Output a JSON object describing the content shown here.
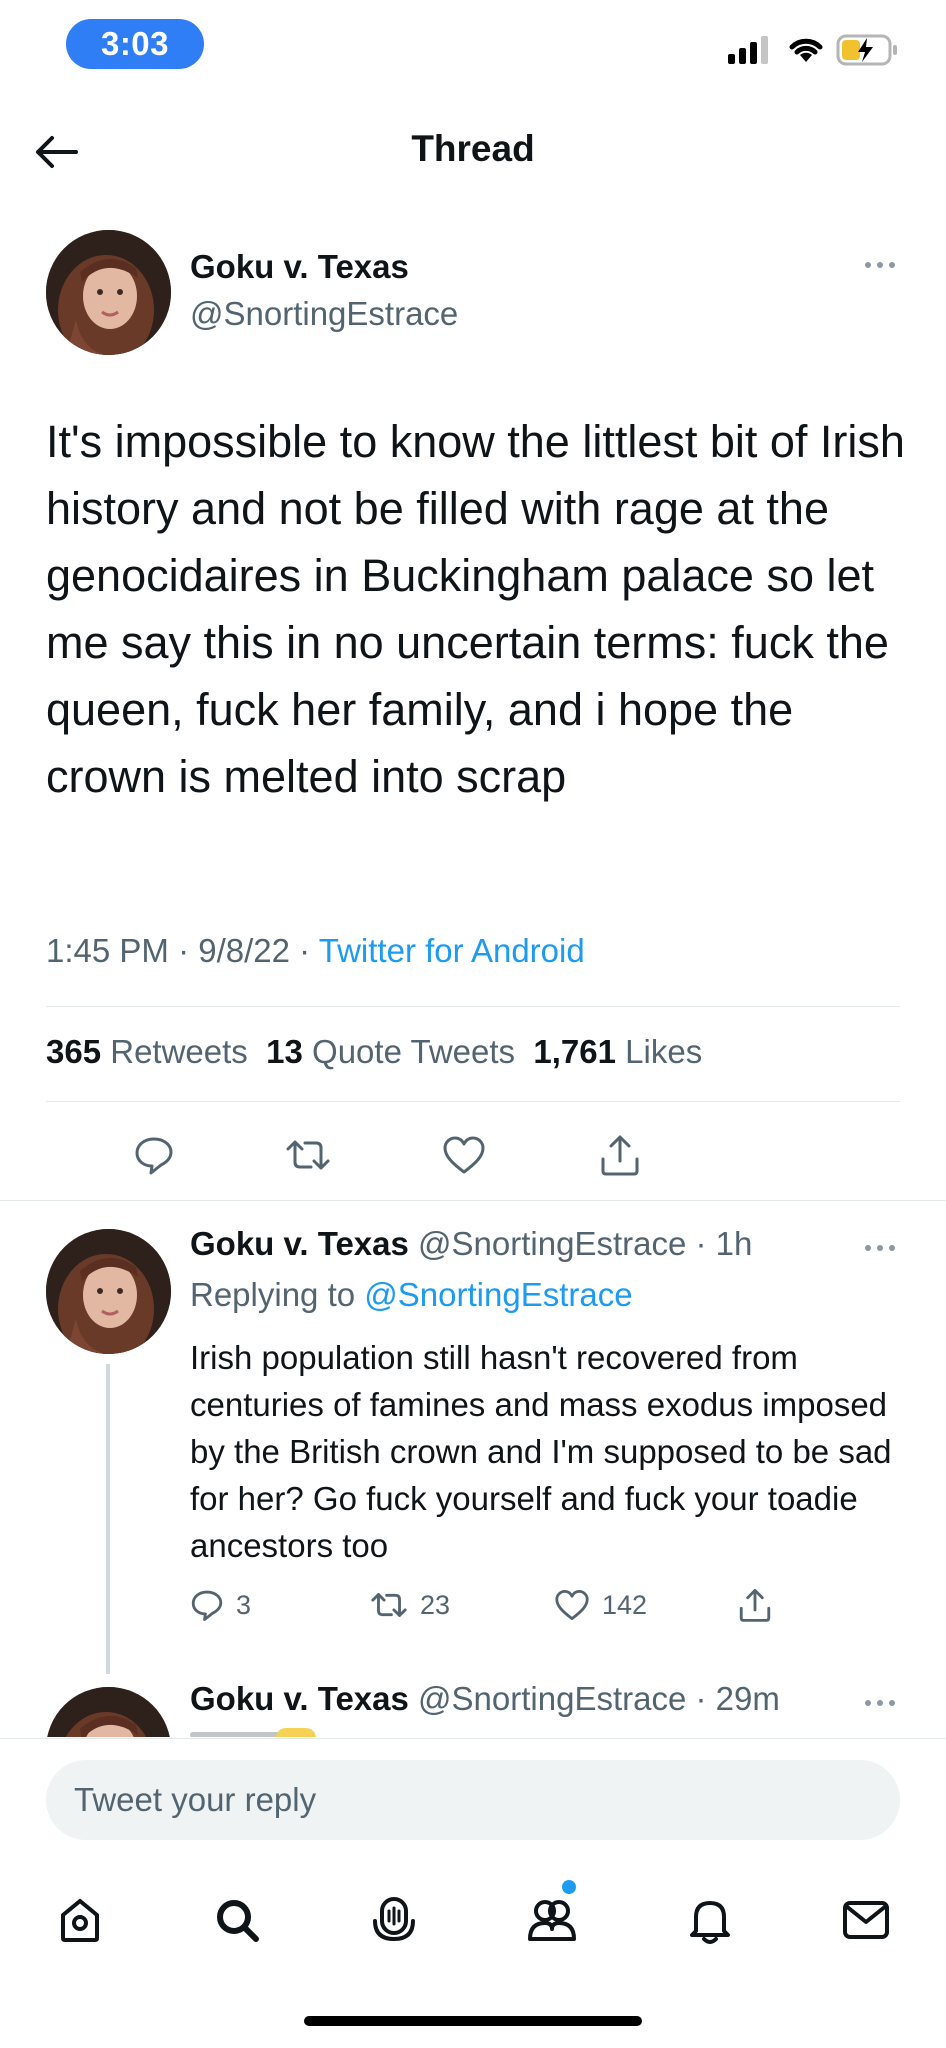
{
  "status_bar": {
    "time": "3:03"
  },
  "header": {
    "title": "Thread"
  },
  "main_tweet": {
    "display_name": "Goku v. Texas",
    "handle": "@SnortingEstrace",
    "text": "It's impossible to know the littlest bit of Irish history and not be filled with rage at the genocidaires in Buckingham palace so let me say this in no uncertain terms: fuck the queen, fuck her family, and i hope the crown is melted into scrap",
    "time": "1:45 PM",
    "separator": "·",
    "date": "9/8/22",
    "source": "Twitter for Android",
    "retweets_count": "365",
    "retweets_label": "Retweets",
    "quotes_count": "13",
    "quotes_label": "Quote Tweets",
    "likes_count": "1,761",
    "likes_label": "Likes"
  },
  "replies": [
    {
      "display_name": "Goku v. Texas",
      "handle": "@SnortingEstrace",
      "age": "· 1h",
      "replying_label": "Replying to",
      "replying_to": "@SnortingEstrace",
      "text": "Irish population still hasn't recovered from centuries of famines and mass exodus imposed by the British crown and I'm supposed to be sad for her? Go fuck yourself and fuck your toadie ancestors too",
      "reply_count": "3",
      "retweet_count": "23",
      "like_count": "142"
    },
    {
      "display_name": "Goku v. Texas",
      "handle": "@SnortingEstrace",
      "age": "· 29m"
    }
  ],
  "composer": {
    "placeholder": "Tweet your reply"
  },
  "colors": {
    "accent": "#1d9bf0",
    "time_pill": "#2f7ef6",
    "muted": "#536471"
  },
  "nav": [
    "home-icon",
    "search-icon",
    "spaces-icon",
    "communities-icon",
    "notifications-icon",
    "messages-icon"
  ]
}
